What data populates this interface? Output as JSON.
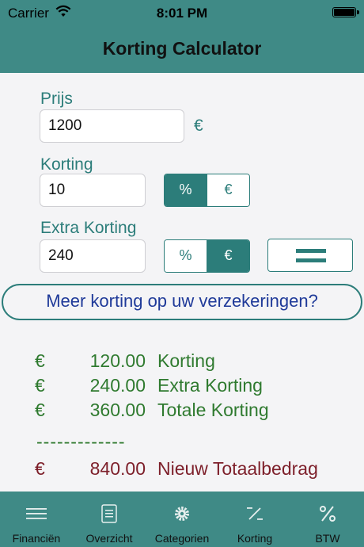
{
  "status_bar": {
    "carrier": "Carrier",
    "time": "8:01 PM"
  },
  "nav": {
    "title": "Korting Calculator"
  },
  "form": {
    "prijs": {
      "label": "Prijs",
      "value": "1200",
      "unit": "€"
    },
    "korting": {
      "label": "Korting",
      "value": "10",
      "options": [
        "%",
        "€"
      ],
      "selected": "%"
    },
    "extra_korting": {
      "label": "Extra Korting",
      "value": "240",
      "options": [
        "%",
        "€"
      ],
      "selected": "€"
    }
  },
  "promo": {
    "label": "Meer korting op uw verzekeringen?"
  },
  "results": [
    {
      "currency": "€",
      "amount": "120.00",
      "label": "Korting"
    },
    {
      "currency": "€",
      "amount": "240.00",
      "label": "Extra Korting"
    },
    {
      "currency": "€",
      "amount": "360.00",
      "label": "Totale Korting"
    }
  ],
  "divider": "-------------",
  "total": {
    "currency": "€",
    "amount": "840.00",
    "label": "Nieuw Totaalbedrag"
  },
  "tabs": [
    {
      "label": "Financiën",
      "icon": "hamburger-icon"
    },
    {
      "label": "Overzicht",
      "icon": "list-icon"
    },
    {
      "label": "Categorien",
      "icon": "gear-icon"
    },
    {
      "label": "Korting",
      "icon": "discount-icon"
    },
    {
      "label": "BTW",
      "icon": "percent-icon"
    }
  ],
  "colors": {
    "bar": "#3f8a86",
    "accent": "#2c7d7a",
    "result_green": "#2f7a2f",
    "total_red": "#7d1f2a",
    "promo_text": "#1f3a99"
  }
}
